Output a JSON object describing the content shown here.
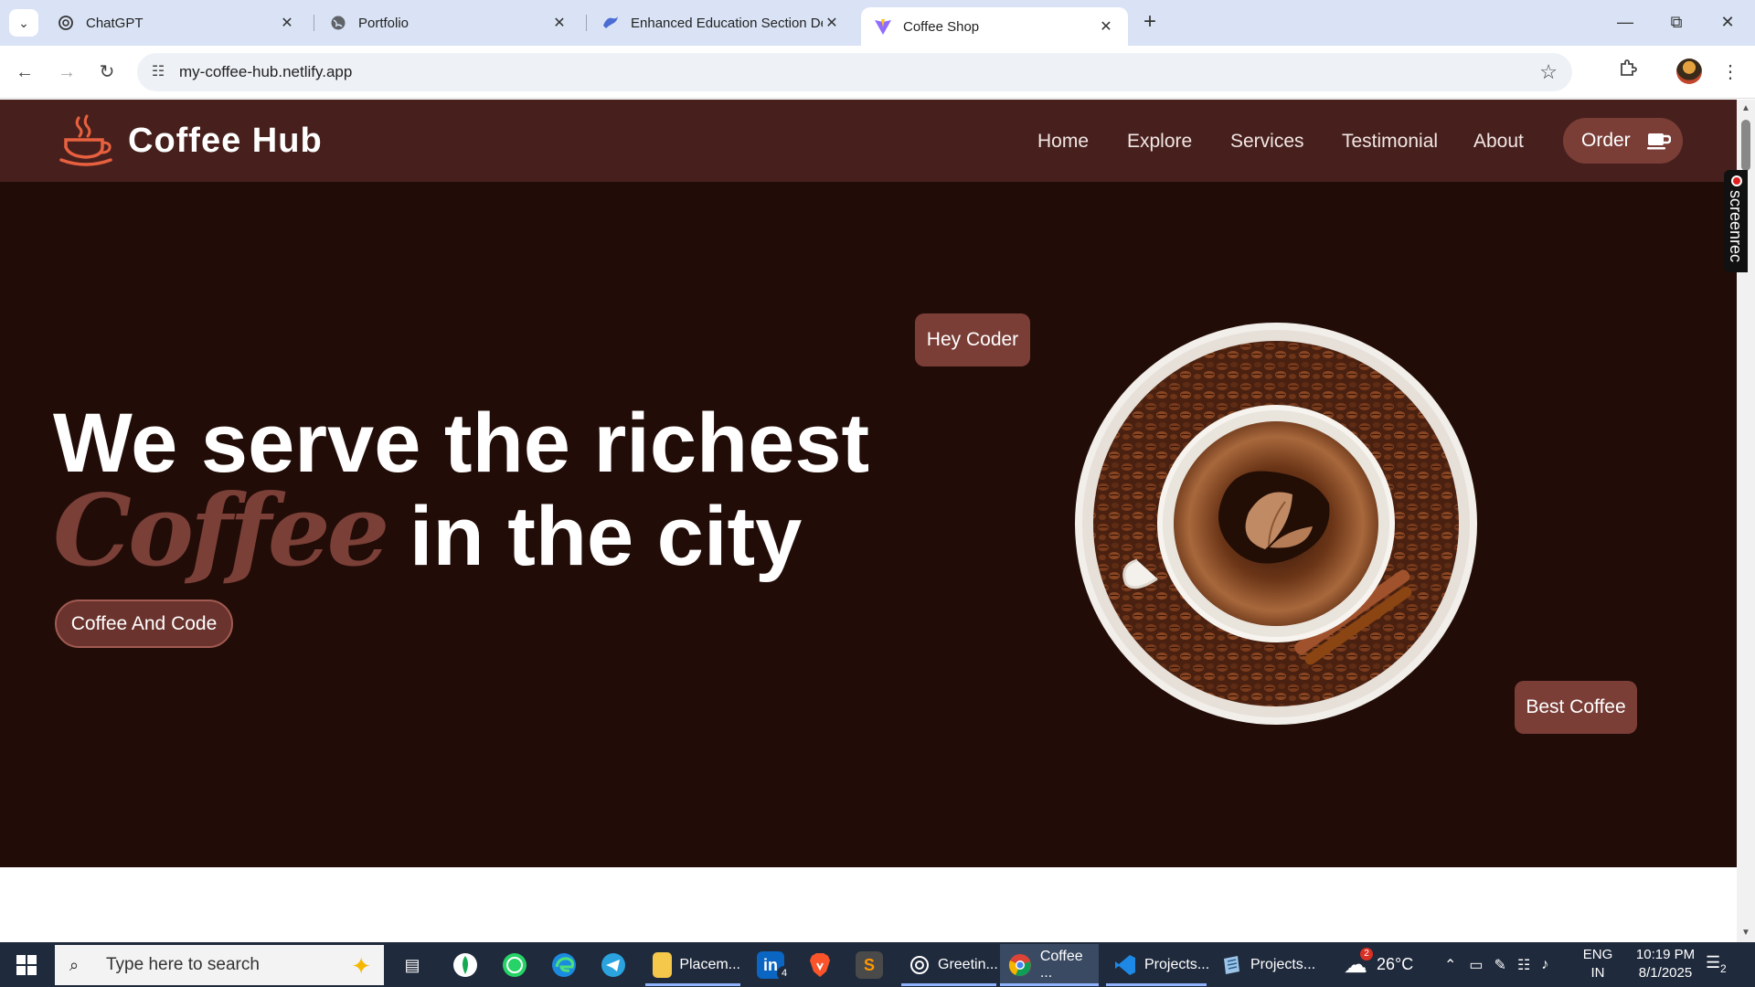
{
  "browser": {
    "tabs": [
      {
        "label": "ChatGPT",
        "icon": "chatgpt-icon"
      },
      {
        "label": "Portfolio",
        "icon": "globe-icon"
      },
      {
        "label": "Enhanced Education Section De",
        "icon": "bird-icon"
      },
      {
        "label": "Coffee Shop",
        "icon": "vite-icon"
      }
    ],
    "url": "my-coffee-hub.netlify.app"
  },
  "site": {
    "brand": "Coffee Hub",
    "nav": [
      "Home",
      "Explore",
      "Services",
      "Testimonial",
      "About"
    ],
    "order_label": "Order",
    "hero_line1": "We serve the richest",
    "hero_word": "Coffee",
    "hero_line2": " in the city",
    "cta_label": "Coffee And Code",
    "badge_top": "Hey Coder",
    "badge_bottom": "Best Coffee",
    "colors": {
      "nav_bg": "#47201d",
      "hero_bg": "#220c07",
      "accent": "#7a3e37"
    }
  },
  "overlay": {
    "screenrec_label": "screenrec"
  },
  "taskbar": {
    "search_placeholder": "Type here to search",
    "apps": [
      {
        "label": "Placem..."
      },
      {
        "label": "Greetin..."
      },
      {
        "label": "Coffee ..."
      },
      {
        "label": "Projects..."
      },
      {
        "label": "Projects..."
      }
    ],
    "linkedin_badge": "4",
    "weather_badge": "2",
    "temperature": "26°C",
    "lang_line1": "ENG",
    "lang_line2": "IN",
    "time": "10:19 PM",
    "date": "8/1/2025",
    "notification_count": "2"
  }
}
